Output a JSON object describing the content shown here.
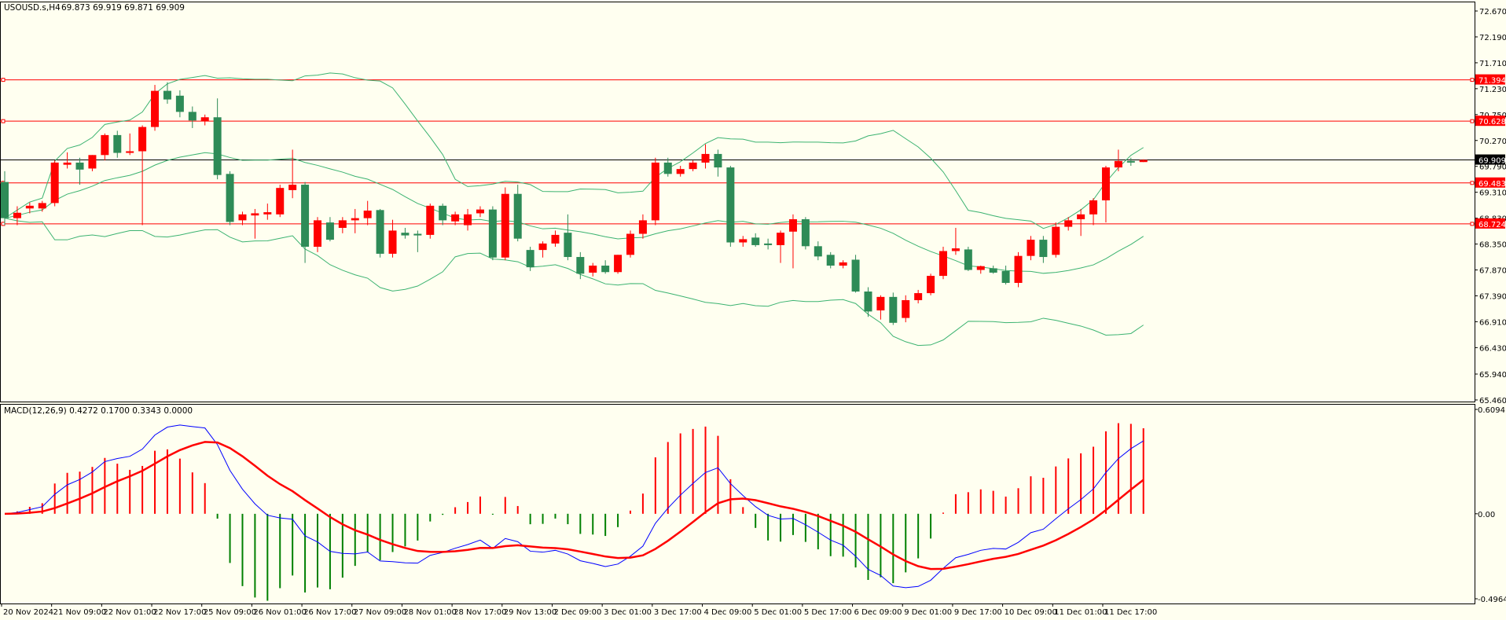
{
  "header": {
    "symbol": "USOUSD.s,H4",
    "ohlc": "69.873 69.919 69.871 69.909"
  },
  "macd_header": {
    "label": "MACD(12,26,9) 0.4272 0.1700 0.3343 0.0000"
  },
  "colors": {
    "background": "#fffff0",
    "bull": "#ff0000",
    "bear": "#2e8b57",
    "bands": "#3cb371",
    "macd": "#0000ff",
    "signal": "#ff0000",
    "hist_pos": "#ff0000",
    "hist_neg": "#008000",
    "level": "#ff0000",
    "current": "#000000"
  },
  "chart_data": [
    {
      "type": "candlestick",
      "title": "USOUSD.s,H4",
      "ylim": [
        65.46,
        72.67
      ],
      "y_ticks": [
        "72.670",
        "72.190",
        "71.710",
        "71.230",
        "70.750",
        "70.270",
        "69.790",
        "69.310",
        "68.830",
        "68.350",
        "67.870",
        "67.390",
        "66.910",
        "66.430",
        "65.940",
        "65.460"
      ],
      "x_labels": [
        "20 Nov 2024",
        "21 Nov 09:00",
        "22 Nov 01:00",
        "22 Nov 17:00",
        "25 Nov 09:00",
        "26 Nov 01:00",
        "26 Nov 17:00",
        "27 Nov 09:00",
        "28 Nov 01:00",
        "28 Nov 17:00",
        "29 Nov 13:00",
        "2 Dec 09:00",
        "3 Dec 01:00",
        "3 Dec 17:00",
        "4 Dec 09:00",
        "5 Dec 01:00",
        "5 Dec 17:00",
        "6 Dec 09:00",
        "9 Dec 01:00",
        "9 Dec 17:00",
        "10 Dec 09:00",
        "11 Dec 01:00",
        "11 Dec 17:00"
      ],
      "x_label_every_bars": 4,
      "levels": [
        {
          "price": 71.394,
          "label": "71.394"
        },
        {
          "price": 70.628,
          "label": "70.628"
        },
        {
          "price": 69.483,
          "label": "69.483"
        },
        {
          "price": 68.724,
          "label": "68.724"
        }
      ],
      "current_price": {
        "price": 69.909,
        "label": "69.909"
      },
      "indicator": "Bollinger Bands (20,2)",
      "ohlc": [
        [
          69.5,
          69.7,
          68.7,
          68.83
        ],
        [
          68.83,
          69.05,
          68.7,
          68.93
        ],
        [
          69.01,
          69.12,
          68.92,
          69.06
        ],
        [
          69.01,
          69.15,
          68.95,
          69.11
        ],
        [
          69.11,
          69.9,
          69.05,
          69.86
        ],
        [
          69.82,
          70.05,
          69.75,
          69.86
        ],
        [
          69.86,
          69.95,
          69.45,
          69.73
        ],
        [
          69.75,
          70.0,
          69.7,
          70.0
        ],
        [
          70.0,
          70.4,
          69.9,
          70.37
        ],
        [
          70.37,
          70.45,
          69.95,
          70.04
        ],
        [
          70.04,
          70.4,
          70.0,
          70.07
        ],
        [
          70.07,
          70.55,
          68.7,
          70.52
        ],
        [
          70.52,
          71.3,
          70.45,
          71.19
        ],
        [
          71.19,
          71.35,
          70.95,
          71.03
        ],
        [
          71.1,
          71.2,
          70.7,
          70.8
        ],
        [
          70.8,
          70.9,
          70.5,
          70.64
        ],
        [
          70.63,
          70.75,
          70.55,
          70.7
        ],
        [
          70.7,
          71.05,
          69.55,
          69.63
        ],
        [
          69.65,
          69.7,
          68.7,
          68.76
        ],
        [
          68.79,
          68.95,
          68.7,
          68.9
        ],
        [
          68.88,
          69.0,
          68.45,
          68.92
        ],
        [
          68.9,
          69.1,
          68.8,
          68.94
        ],
        [
          68.9,
          69.45,
          68.85,
          69.39
        ],
        [
          69.35,
          70.1,
          69.2,
          69.45
        ],
        [
          69.45,
          69.5,
          68.0,
          68.3
        ],
        [
          68.3,
          68.85,
          68.2,
          68.79
        ],
        [
          68.75,
          68.85,
          68.4,
          68.43
        ],
        [
          68.65,
          68.85,
          68.55,
          68.79
        ],
        [
          68.79,
          69.0,
          68.55,
          68.83
        ],
        [
          68.83,
          69.15,
          68.7,
          68.97
        ],
        [
          68.98,
          69.0,
          68.1,
          68.17
        ],
        [
          68.17,
          68.8,
          68.1,
          68.6
        ],
        [
          68.56,
          68.65,
          68.45,
          68.51
        ],
        [
          68.54,
          68.6,
          68.2,
          68.51
        ],
        [
          68.52,
          69.1,
          68.45,
          69.06
        ],
        [
          69.06,
          69.1,
          68.7,
          68.79
        ],
        [
          68.77,
          68.95,
          68.7,
          68.9
        ],
        [
          68.7,
          69.0,
          68.6,
          68.9
        ],
        [
          68.92,
          69.05,
          68.85,
          68.99
        ],
        [
          68.99,
          69.05,
          68.05,
          68.1
        ],
        [
          68.1,
          69.4,
          68.05,
          69.28
        ],
        [
          69.28,
          69.45,
          68.4,
          68.45
        ],
        [
          68.24,
          68.3,
          67.85,
          67.92
        ],
        [
          68.24,
          68.4,
          68.1,
          68.36
        ],
        [
          68.36,
          68.6,
          68.3,
          68.52
        ],
        [
          68.56,
          68.9,
          68.05,
          68.11
        ],
        [
          68.11,
          68.2,
          67.7,
          67.8
        ],
        [
          67.82,
          68.0,
          67.75,
          67.95
        ],
        [
          67.95,
          68.05,
          67.8,
          67.83
        ],
        [
          67.83,
          68.15,
          67.8,
          68.15
        ],
        [
          68.15,
          68.6,
          68.1,
          68.54
        ],
        [
          68.54,
          68.9,
          68.45,
          68.79
        ],
        [
          68.79,
          69.95,
          68.7,
          69.86
        ],
        [
          69.86,
          69.95,
          69.6,
          69.65
        ],
        [
          69.65,
          69.8,
          69.6,
          69.74
        ],
        [
          69.74,
          69.9,
          69.7,
          69.86
        ],
        [
          69.86,
          70.2,
          69.75,
          70.02
        ],
        [
          70.02,
          70.1,
          69.6,
          69.77
        ],
        [
          69.77,
          69.8,
          68.3,
          68.38
        ],
        [
          68.38,
          68.5,
          68.3,
          68.44
        ],
        [
          68.47,
          68.55,
          68.3,
          68.33
        ],
        [
          68.36,
          68.45,
          68.25,
          68.33
        ],
        [
          68.33,
          68.6,
          68.0,
          68.56
        ],
        [
          68.58,
          68.9,
          67.9,
          68.81
        ],
        [
          68.81,
          68.85,
          68.25,
          68.31
        ],
        [
          68.31,
          68.4,
          68.05,
          68.12
        ],
        [
          68.15,
          68.2,
          67.9,
          67.95
        ],
        [
          67.95,
          68.05,
          67.9,
          68.01
        ],
        [
          68.06,
          68.15,
          67.45,
          67.47
        ],
        [
          67.47,
          67.55,
          67.0,
          67.1
        ],
        [
          67.12,
          67.4,
          66.95,
          67.37
        ],
        [
          67.37,
          67.45,
          66.85,
          66.89
        ],
        [
          66.98,
          67.4,
          66.9,
          67.31
        ],
        [
          67.31,
          67.5,
          67.25,
          67.44
        ],
        [
          67.44,
          67.8,
          67.4,
          67.76
        ],
        [
          67.76,
          68.3,
          67.7,
          68.22
        ],
        [
          68.22,
          68.65,
          68.15,
          68.27
        ],
        [
          68.25,
          68.3,
          67.85,
          67.87
        ],
        [
          67.87,
          67.95,
          67.8,
          67.94
        ],
        [
          67.9,
          67.95,
          67.8,
          67.82
        ],
        [
          67.85,
          67.95,
          67.6,
          67.63
        ],
        [
          67.63,
          68.2,
          67.55,
          68.13
        ],
        [
          68.13,
          68.5,
          68.05,
          68.43
        ],
        [
          68.43,
          68.5,
          68.0,
          68.11
        ],
        [
          68.15,
          68.75,
          68.1,
          68.67
        ],
        [
          68.67,
          68.85,
          68.6,
          68.79
        ],
        [
          68.81,
          69.0,
          68.5,
          68.9
        ],
        [
          68.9,
          69.2,
          68.7,
          69.16
        ],
        [
          69.16,
          69.8,
          68.75,
          69.77
        ],
        [
          69.77,
          70.1,
          69.7,
          69.89
        ],
        [
          69.89,
          69.95,
          69.8,
          69.86
        ],
        [
          69.87,
          69.92,
          69.87,
          69.91
        ]
      ]
    },
    {
      "type": "macd",
      "title": "MACD(12,26,9)",
      "params": [
        12,
        26,
        9
      ],
      "values_shown": [
        0.4272,
        0.17,
        0.3343,
        0.0
      ],
      "ylim": [
        -0.4964,
        0.6094
      ],
      "y_ticks": [
        "0.6094",
        "0.00",
        "-0.4964"
      ]
    }
  ]
}
